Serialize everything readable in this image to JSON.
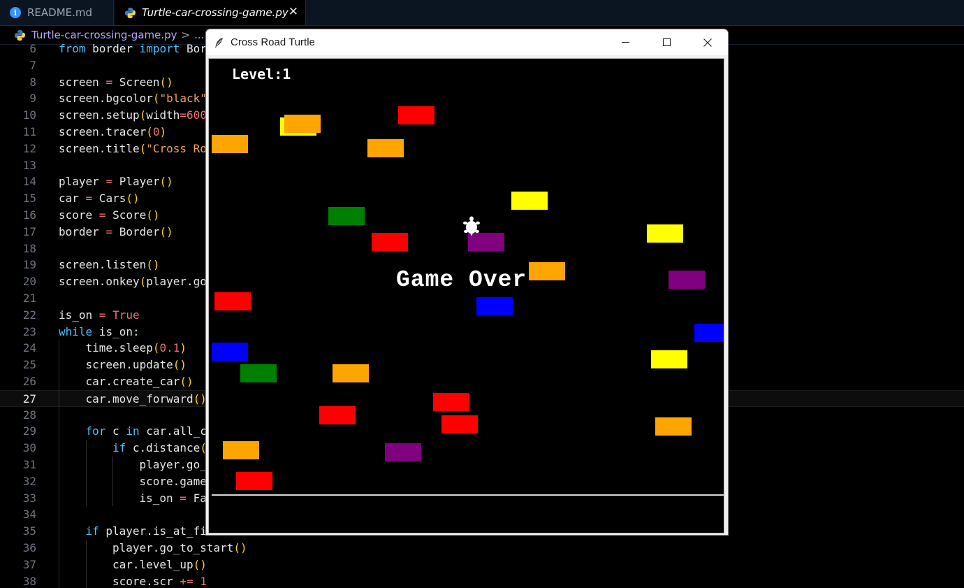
{
  "tabs": [
    {
      "label": "README.md",
      "icon": "info-icon",
      "active": false
    },
    {
      "label": "Turtle-car-crossing-game.py",
      "icon": "python-icon",
      "active": true
    }
  ],
  "tab_close_glyph": "✕",
  "breadcrumb": {
    "file": "Turtle-car-crossing-game.py",
    "separator": ">",
    "more": "..."
  },
  "editor": {
    "current_line": 27,
    "lines": [
      {
        "n": "6",
        "indent": 0,
        "text": "from border import Bor"
      },
      {
        "n": "7",
        "indent": 0,
        "text": ""
      },
      {
        "n": "8",
        "indent": 0,
        "text": "screen = Screen()"
      },
      {
        "n": "9",
        "indent": 0,
        "text": "screen.bgcolor(\"black\""
      },
      {
        "n": "10",
        "indent": 0,
        "text": "screen.setup(width=600"
      },
      {
        "n": "11",
        "indent": 0,
        "text": "screen.tracer(0)"
      },
      {
        "n": "12",
        "indent": 0,
        "text": "screen.title(\"Cross Ro"
      },
      {
        "n": "13",
        "indent": 0,
        "text": ""
      },
      {
        "n": "14",
        "indent": 0,
        "text": "player = Player()"
      },
      {
        "n": "15",
        "indent": 0,
        "text": "car = Cars()"
      },
      {
        "n": "16",
        "indent": 0,
        "text": "score = Score()"
      },
      {
        "n": "17",
        "indent": 0,
        "text": "border = Border()"
      },
      {
        "n": "18",
        "indent": 0,
        "text": ""
      },
      {
        "n": "19",
        "indent": 0,
        "text": "screen.listen()"
      },
      {
        "n": "20",
        "indent": 0,
        "text": "screen.onkey(player.go"
      },
      {
        "n": "21",
        "indent": 0,
        "text": ""
      },
      {
        "n": "22",
        "indent": 0,
        "text": "is_on = True"
      },
      {
        "n": "23",
        "indent": 0,
        "text": "while is_on:"
      },
      {
        "n": "24",
        "indent": 1,
        "text": "time.sleep(0.1)"
      },
      {
        "n": "25",
        "indent": 1,
        "text": "screen.update()"
      },
      {
        "n": "26",
        "indent": 1,
        "text": "car.create_car()"
      },
      {
        "n": "27",
        "indent": 1,
        "text": "car.move_forward()"
      },
      {
        "n": "28",
        "indent": 0,
        "text": ""
      },
      {
        "n": "29",
        "indent": 1,
        "text": "for c in car.all_c"
      },
      {
        "n": "30",
        "indent": 2,
        "text": "if c.distance("
      },
      {
        "n": "31",
        "indent": 3,
        "text": "player.go_"
      },
      {
        "n": "32",
        "indent": 3,
        "text": "score.game"
      },
      {
        "n": "33",
        "indent": 3,
        "text": "is_on = Fa"
      },
      {
        "n": "34",
        "indent": 0,
        "text": ""
      },
      {
        "n": "35",
        "indent": 1,
        "text": "if player.is_at_fi"
      },
      {
        "n": "36",
        "indent": 2,
        "text": "player.go_to_start()"
      },
      {
        "n": "37",
        "indent": 2,
        "text": "car.level_up()"
      },
      {
        "n": "38",
        "indent": 2,
        "text": "score.scr += 1"
      }
    ]
  },
  "syntax_colors": {
    "default": "#e6e6e6",
    "keyword": "#4fc1ff",
    "control": "#4fc1ff",
    "string": "#f0a35e",
    "number": "#f07178",
    "bool": "#f07178",
    "paren": "#ffd700",
    "attr": "#9cdcfe"
  },
  "window": {
    "title": "Cross Road Turtle",
    "minimize_glyph": "—",
    "maximize_glyph": "☐",
    "close_glyph": "✕"
  },
  "game": {
    "level_text": "Level:1",
    "game_over_text": "Game Over",
    "colors": {
      "red": "#ff0000",
      "orange": "#ffa500",
      "yellow": "#ffff00",
      "green": "#008000",
      "blue": "#0000ff",
      "purple": "#800080",
      "player": "#ffffff",
      "background": "#000000"
    },
    "cars": [
      {
        "color": "yellow"
      },
      {
        "color": "orange"
      },
      {
        "color": "red"
      },
      {
        "color": "orange"
      },
      {
        "color": "orange"
      },
      {
        "color": "yellow"
      },
      {
        "color": "green"
      },
      {
        "color": "red"
      },
      {
        "color": "purple"
      },
      {
        "color": "yellow"
      },
      {
        "color": "orange"
      },
      {
        "color": "purple"
      },
      {
        "color": "red"
      },
      {
        "color": "blue"
      },
      {
        "color": "blue"
      },
      {
        "color": "blue"
      },
      {
        "color": "green"
      },
      {
        "color": "orange"
      },
      {
        "color": "yellow"
      },
      {
        "color": "red"
      },
      {
        "color": "red"
      },
      {
        "color": "red"
      },
      {
        "color": "orange"
      },
      {
        "color": "orange"
      },
      {
        "color": "purple"
      },
      {
        "color": "red"
      }
    ]
  }
}
